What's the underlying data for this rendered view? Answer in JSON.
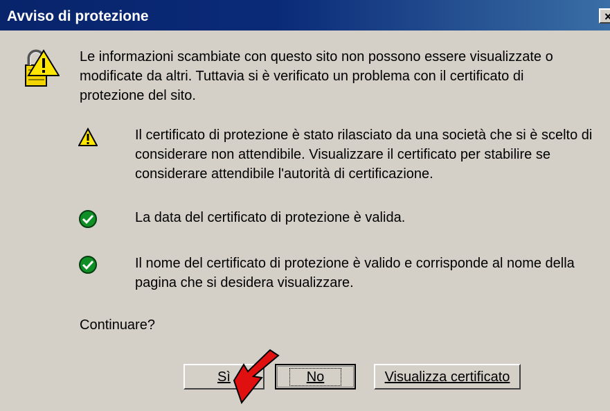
{
  "window": {
    "title": "Avviso di protezione",
    "close_glyph": "×"
  },
  "icons": {
    "main": "security-warning-lock-icon",
    "warning": "warning-triangle-icon",
    "valid": "green-checkmark-icon",
    "arrow": "red-pointer-arrow"
  },
  "message": {
    "intro": "Le informazioni scambiate con questo sito non possono essere visualizzate o modificate da altri. Tuttavia si è verificato un problema con il certificato di protezione del sito.",
    "items": [
      {
        "status": "warning",
        "text": "Il certificato di protezione è stato rilasciato da una società che si è scelto di considerare non attendibile. Visualizzare il certificato per stabilire se considerare attendibile l'autorità di certificazione."
      },
      {
        "status": "valid",
        "text": "La data del certificato di protezione è valida."
      },
      {
        "status": "valid",
        "text": "Il nome del certificato di protezione è valido e corrisponde al nome della pagina che si desidera visualizzare."
      }
    ],
    "question": "Continuare?"
  },
  "buttons": {
    "yes": "Sì",
    "no": "No",
    "view_certificate": "Visualizza certificato"
  },
  "colors": {
    "titlebar_start": "#08246b",
    "titlebar_end": "#3a6ea5",
    "dialog_bg": "#d4d0c8",
    "warning_yellow": "#ffe600",
    "check_green": "#0f8f25",
    "arrow_red": "#e01010"
  }
}
